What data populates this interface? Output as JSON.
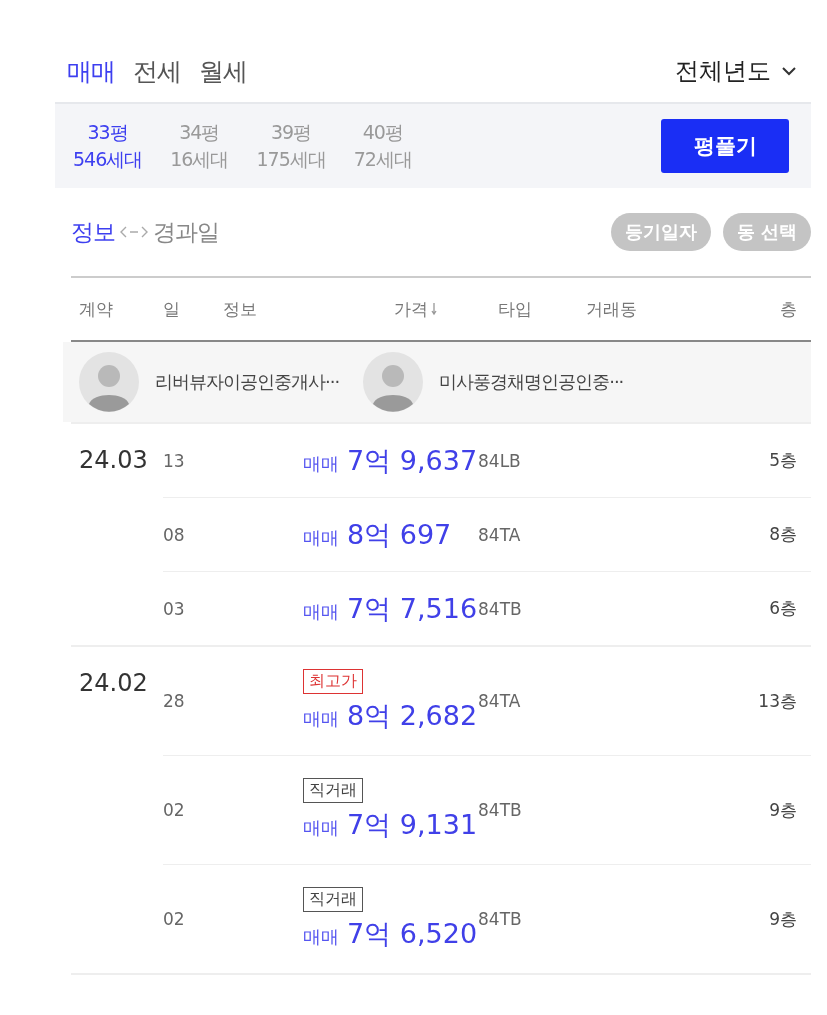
{
  "deal_tabs": [
    {
      "label": "매매",
      "selected": true
    },
    {
      "label": "전세",
      "selected": false
    },
    {
      "label": "월세",
      "selected": false
    }
  ],
  "year_filter": "전체년도",
  "size_tabs": [
    {
      "area": "33평",
      "households": "546세대",
      "selected": true
    },
    {
      "area": "34평",
      "households": "16세대",
      "selected": false
    },
    {
      "area": "39평",
      "households": "175세대",
      "selected": false
    },
    {
      "area": "40평",
      "households": "72세대",
      "selected": false
    }
  ],
  "size_button": "평풀기",
  "view_toggle": [
    {
      "label": "정보",
      "selected": true
    },
    {
      "label": "경과일",
      "selected": false
    }
  ],
  "chips": [
    "등기일자",
    "동 선택"
  ],
  "table": {
    "columns": [
      "계약",
      "일",
      "정보",
      "가격",
      "타입",
      "거래동",
      "층"
    ],
    "agents": [
      "리버뷰자이공인중개사···",
      "미사풍경채명인공인중···"
    ],
    "groups": [
      {
        "month": "24.03",
        "rows": [
          {
            "day": "13",
            "deal": "매매",
            "price": "7억 9,637",
            "type": "84LB",
            "floor": "5층"
          },
          {
            "day": "08",
            "deal": "매매",
            "price": "8억 697",
            "type": "84TA",
            "floor": "8층"
          },
          {
            "day": "03",
            "deal": "매매",
            "price": "7억 7,516",
            "type": "84TB",
            "floor": "6층"
          }
        ]
      },
      {
        "month": "24.02",
        "rows": [
          {
            "day": "28",
            "tag": {
              "kind": "highest",
              "label": "최고가"
            },
            "deal": "매매",
            "price": "8억 2,682",
            "type": "84TA",
            "floor": "13층"
          },
          {
            "day": "02",
            "tag": {
              "kind": "direct",
              "label": "직거래"
            },
            "deal": "매매",
            "price": "7억 9,131",
            "type": "84TB",
            "floor": "9층"
          },
          {
            "day": "02",
            "tag": {
              "kind": "direct",
              "label": "직거래"
            },
            "deal": "매매",
            "price": "7억 6,520",
            "type": "84TB",
            "floor": "9층"
          }
        ]
      }
    ]
  }
}
